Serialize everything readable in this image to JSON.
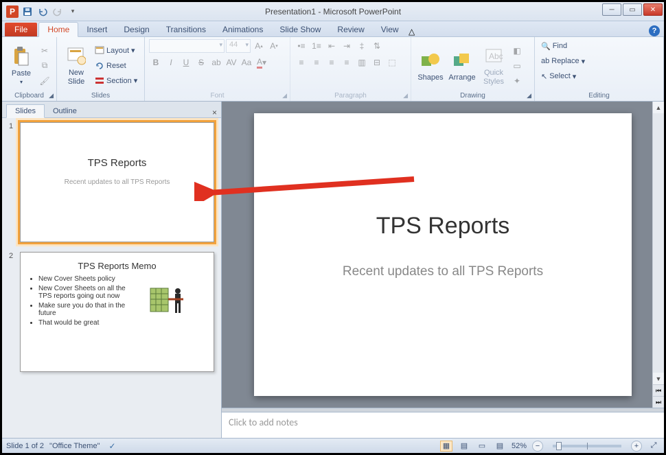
{
  "title": "Presentation1 - Microsoft PowerPoint",
  "tabs": {
    "file": "File",
    "home": "Home",
    "insert": "Insert",
    "design": "Design",
    "transitions": "Transitions",
    "animations": "Animations",
    "slideshow": "Slide Show",
    "review": "Review",
    "view": "View"
  },
  "ribbon": {
    "clipboard": {
      "label": "Clipboard",
      "paste": "Paste"
    },
    "slides": {
      "label": "Slides",
      "new": "New\nSlide",
      "layout": "Layout",
      "reset": "Reset",
      "section": "Section"
    },
    "font": {
      "label": "Font",
      "size": "44",
      "family": ""
    },
    "paragraph": {
      "label": "Paragraph"
    },
    "drawing": {
      "label": "Drawing",
      "shapes": "Shapes",
      "arrange": "Arrange",
      "quick": "Quick\nStyles"
    },
    "editing": {
      "label": "Editing",
      "find": "Find",
      "replace": "Replace",
      "select": "Select"
    }
  },
  "sidepanel": {
    "slides": "Slides",
    "outline": "Outline"
  },
  "thumbs": {
    "1": {
      "title": "TPS Reports",
      "subtitle": "Recent updates to all TPS Reports"
    },
    "2": {
      "title": "TPS Reports Memo",
      "b1": "New Cover Sheets policy",
      "b2": "New Cover Sheets on all the TPS reports going out now",
      "b3": "Make sure you do that in the future",
      "b4": "That would be great"
    }
  },
  "slide": {
    "title": "TPS Reports",
    "subtitle": "Recent updates to all TPS Reports"
  },
  "notes_placeholder": "Click to add notes",
  "status": {
    "slide": "Slide 1 of 2",
    "theme": "\"Office Theme\"",
    "zoom": "52%"
  }
}
